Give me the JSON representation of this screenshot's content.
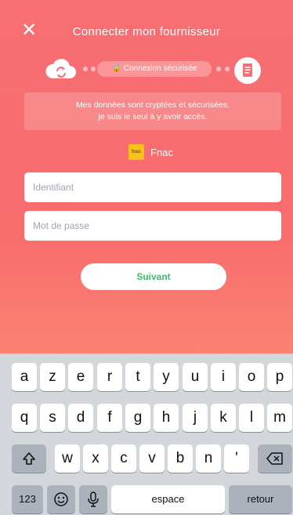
{
  "header": {
    "close_icon": "close-icon",
    "title": "Connecter mon fournisseur"
  },
  "progress": {
    "secure_label": "Connexion sécurisée"
  },
  "info": {
    "line1": "Mes données sont cryptées et sécurisées,",
    "line2": "je suis le seul à y avoir accès."
  },
  "provider": {
    "logo_text": "fnac",
    "name": "Fnac"
  },
  "form": {
    "identifiant_placeholder": "Identifiant",
    "password_placeholder": "Mot de passe",
    "next_label": "Suivant"
  },
  "keyboard": {
    "row1": [
      "a",
      "z",
      "e",
      "r",
      "t",
      "y",
      "u",
      "i",
      "o",
      "p"
    ],
    "row2": [
      "q",
      "s",
      "d",
      "f",
      "g",
      "h",
      "j",
      "k",
      "l",
      "m"
    ],
    "row3": [
      "w",
      "x",
      "c",
      "v",
      "b",
      "n",
      "'"
    ],
    "numbers_label": "123",
    "space_label": "espace",
    "return_label": "retour"
  },
  "colors": {
    "gradient_top": "#f76f74",
    "gradient_bottom": "#fb9d7e",
    "next_text": "#3ebd6a",
    "fnac_yellow": "#f7c21c"
  }
}
